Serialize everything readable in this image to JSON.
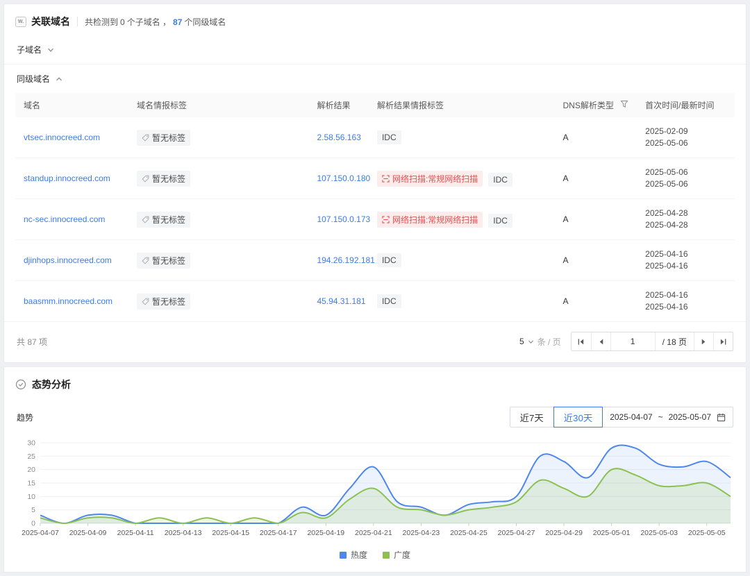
{
  "panel1": {
    "icon_text": "W.",
    "title": "关联域名",
    "summary": {
      "prefix": "共检测到",
      "subdomain_count": "0",
      "mid": "个子域名 ，",
      "sibling_count": "87",
      "suffix": "个同级域名"
    },
    "sections": {
      "subdomain": "子域名",
      "sibling": "同级域名"
    },
    "table": {
      "headers": [
        "域名",
        "域名情报标签",
        "解析结果",
        "解析结果情报标签",
        "DNS解析类型",
        "首次时间/最新时间"
      ],
      "rows": [
        {
          "domain": "vtsec.innocreed.com",
          "tag": "暂无标签",
          "ip": "2.58.56.163",
          "scan_tag": null,
          "result_tags": [
            "IDC"
          ],
          "dns_type": "A",
          "first_time": "2025-02-09",
          "last_time": "2025-05-06"
        },
        {
          "domain": "standup.innocreed.com",
          "tag": "暂无标签",
          "ip": "107.150.0.180",
          "scan_tag": "网络扫描:常规网络扫描",
          "result_tags": [
            "IDC"
          ],
          "dns_type": "A",
          "first_time": "2025-05-06",
          "last_time": "2025-05-06"
        },
        {
          "domain": "nc-sec.innocreed.com",
          "tag": "暂无标签",
          "ip": "107.150.0.173",
          "scan_tag": "网络扫描:常规网络扫描",
          "result_tags": [
            "IDC"
          ],
          "dns_type": "A",
          "first_time": "2025-04-28",
          "last_time": "2025-04-28"
        },
        {
          "domain": "djinhops.innocreed.com",
          "tag": "暂无标签",
          "ip": "194.26.192.181",
          "scan_tag": null,
          "result_tags": [
            "IDC"
          ],
          "dns_type": "A",
          "first_time": "2025-04-16",
          "last_time": "2025-04-16"
        },
        {
          "domain": "baasmm.innocreed.com",
          "tag": "暂无标签",
          "ip": "45.94.31.181",
          "scan_tag": null,
          "result_tags": [
            "IDC"
          ],
          "dns_type": "A",
          "first_time": "2025-04-16",
          "last_time": "2025-04-16"
        }
      ]
    },
    "pagination": {
      "total": "共 87 项",
      "page_size": "5",
      "per_page_label": "条 / 页",
      "current_page": "1",
      "pages_label": "/ 18 页"
    }
  },
  "panel2": {
    "title": "态势分析",
    "trend_label": "趋势",
    "buttons": {
      "last7": "近7天",
      "last30": "近30天"
    },
    "date_range": {
      "start": "2025-04-07",
      "separator": "~",
      "end": "2025-05-07"
    }
  },
  "colors": {
    "accent_blue": "#3a7bec",
    "line_blue": "#4e86ec",
    "line_green": "#8cc152",
    "fill_blue": "rgba(78,134,236,0.10)",
    "fill_green": "rgba(140,193,82,0.16)",
    "badge_red_text": "#e25350",
    "badge_red_bg": "#fdecec"
  },
  "chart_data": {
    "type": "area",
    "title": "趋势",
    "xlabel": "",
    "ylabel": "",
    "ylim": [
      0,
      30
    ],
    "yticks": [
      0,
      5,
      10,
      15,
      20,
      25,
      30
    ],
    "grid": true,
    "legend_position": "bottom",
    "x_tick_every": 2,
    "x": [
      "2025-04-07",
      "2025-04-08",
      "2025-04-09",
      "2025-04-10",
      "2025-04-11",
      "2025-04-12",
      "2025-04-13",
      "2025-04-14",
      "2025-04-15",
      "2025-04-16",
      "2025-04-17",
      "2025-04-18",
      "2025-04-19",
      "2025-04-20",
      "2025-04-21",
      "2025-04-22",
      "2025-04-23",
      "2025-04-24",
      "2025-04-25",
      "2025-04-26",
      "2025-04-27",
      "2025-04-28",
      "2025-04-29",
      "2025-04-30",
      "2025-05-01",
      "2025-05-02",
      "2025-05-03",
      "2025-05-04",
      "2025-05-05",
      "2025-05-06"
    ],
    "series": [
      {
        "name": "热度",
        "color": "#4e86ec",
        "fill": "rgba(78,134,236,0.10)",
        "values": [
          3,
          0,
          3,
          3,
          0,
          0,
          0,
          0,
          0,
          0,
          0,
          6,
          3,
          13,
          21,
          8,
          6,
          3,
          7,
          8,
          10,
          25,
          23,
          17,
          28,
          28,
          22,
          21,
          23,
          17
        ]
      },
      {
        "name": "广度",
        "color": "#8cc152",
        "fill": "rgba(140,193,82,0.16)",
        "values": [
          2,
          0,
          2,
          2,
          0,
          2,
          0,
          2,
          0,
          2,
          0,
          4,
          2,
          9,
          13,
          6,
          5,
          3,
          5,
          6,
          8,
          16,
          13,
          10,
          20,
          18,
          14,
          14,
          15,
          10
        ]
      }
    ]
  }
}
